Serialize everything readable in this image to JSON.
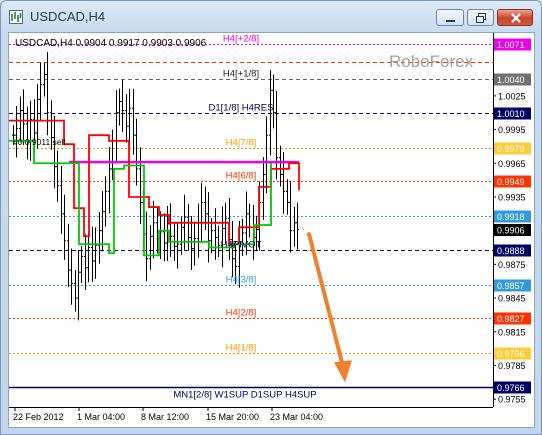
{
  "window": {
    "title": "USDCAD,H4",
    "app_icon": "chart-bars-icon",
    "controls": {
      "minimize": "minimize-icon",
      "maximize": "maximize-icon",
      "close": "close-icon"
    }
  },
  "chart_header": "USDCAD,H4  0.9904 0.9917 0.9903 0.9906",
  "brand": {
    "text": "RoboForex",
    "color": "#a0a0a0"
  },
  "chart_data": {
    "type": "line",
    "symbol": "USDCAD",
    "timeframe": "H4",
    "ohlc": {
      "open": 0.9904,
      "high": 0.9917,
      "low": 0.9903,
      "close": 0.9906
    },
    "ylim": [
      0.9748,
      1.0081
    ],
    "price_ticks": [
      1.0025,
      0.9995,
      0.9965,
      0.9935,
      0.9875,
      0.9845,
      0.9815,
      0.9785,
      0.9755
    ],
    "time_ticks": [
      "22 Feb 2012",
      "1 Mar 04:00",
      "8 Mar 12:00",
      "15 Mar 20:00",
      "23 Mar 04:00"
    ],
    "grid": false,
    "levels": [
      {
        "label": "H4[+2/8]",
        "price": 1.0071,
        "label_color": "#ee00ee",
        "line_color": "#ee00ee",
        "badge_bg": "#ee00ee",
        "badge_fg": "#ffffff",
        "style": "dotted",
        "label_pos": "center"
      },
      {
        "label": "",
        "price": 1.0055,
        "label_color": "#ff3300",
        "line_color": "#ff3300",
        "badge_bg": "",
        "badge_fg": "",
        "style": "dashed",
        "label_pos": "center"
      },
      {
        "label": "H4[+1/8]",
        "price": 1.004,
        "label_color": "#222222",
        "line_color": "#666666",
        "badge_bg": "#707070",
        "badge_fg": "#ffffff",
        "style": "dashed",
        "label_pos": "center"
      },
      {
        "label": "D1[1/8] H4RES",
        "price": 1.001,
        "label_color": "#000066",
        "line_color": "#000066",
        "badge_bg": "#000066",
        "badge_fg": "#ffffff",
        "style": "dashed",
        "label_pos": "center"
      },
      {
        "label": "H4[7/8]",
        "price": 0.9979,
        "label_color": "#ff9900",
        "line_color": "#b8b800",
        "badge_bg": "#ffcc33",
        "badge_fg": "#ffffff",
        "style": "dotted",
        "label_pos": "center"
      },
      {
        "label": "H4[6/8]",
        "price": 0.9949,
        "label_color": "#ff3300",
        "line_color": "#ff3300",
        "badge_bg": "#ff3300",
        "badge_fg": "#ffffff",
        "style": "dotted",
        "label_pos": "center"
      },
      {
        "label": "",
        "price": 0.9918,
        "label_color": "#3399dd",
        "line_color": "#3399dd",
        "badge_bg": "#3399dd",
        "badge_fg": "#ffffff",
        "style": "dotted",
        "label_pos": "center"
      },
      {
        "label": "H4PIVOT",
        "price": 0.9888,
        "label_color": "#000066",
        "line_color": "#000066",
        "badge_bg": "#000066",
        "badge_fg": "#ffffff",
        "style": "dashed",
        "label_pos": "center"
      },
      {
        "label": "H4[3/8]",
        "price": 0.9857,
        "label_color": "#3399dd",
        "line_color": "#3399dd",
        "badge_bg": "#3399dd",
        "badge_fg": "#ffffff",
        "style": "dotted",
        "label_pos": "center"
      },
      {
        "label": "H4[2/8]",
        "price": 0.9827,
        "label_color": "#ff3300",
        "line_color": "#ff3300",
        "badge_bg": "#ff3300",
        "badge_fg": "#ffffff",
        "style": "dotted",
        "label_pos": "center"
      },
      {
        "label": "H4[1/8]",
        "price": 0.9796,
        "label_color": "#ff9900",
        "line_color": "#ff9900",
        "badge_bg": "#ffcc33",
        "badge_fg": "#ffffff",
        "style": "dotted",
        "label_pos": "center"
      },
      {
        "label": "MN1[2/8] W1SUP D1SUP H4SUP",
        "price": 0.9766,
        "label_color": "#000066",
        "line_color": "#000066",
        "badge_bg": "#000066",
        "badge_fg": "#ffffff",
        "style": "solid",
        "label_pos": "center"
      }
    ],
    "current_price": {
      "price": 0.9906,
      "badge_bg": "#000000",
      "badge_fg": "#ffffff"
    },
    "left_label": {
      "text": "#0 0.9011 sell",
      "price": 0.9984
    },
    "bars_close": [
      0.999,
      0.9996,
      1.0012,
      1.0,
      0.9984,
      1.0004,
      0.9992,
      1.0022,
      1.0035,
      1.0044,
      1.001,
      0.9988,
      0.9962,
      0.9945,
      0.992,
      0.9896,
      0.987,
      0.9858,
      0.9845,
      0.9868,
      0.9882,
      0.9872,
      0.989,
      0.9878,
      0.9892,
      0.9905,
      0.9922,
      0.994,
      0.996,
      0.9985,
      1.001,
      1.002,
      1.0012,
      0.9998,
      1.0014,
      0.999,
      0.996,
      0.993,
      0.9902,
      0.988,
      0.99,
      0.9912,
      0.9898,
      0.9904,
      0.9894,
      0.9911,
      0.99,
      0.9891,
      0.9893,
      0.9908,
      0.9917,
      0.9899,
      0.9889,
      0.9898,
      0.9912,
      0.993,
      0.992,
      0.9896,
      0.9905,
      0.9899,
      0.9892,
      0.9907,
      0.9916,
      0.9897,
      0.988,
      0.9873,
      0.9895,
      0.9903,
      0.992,
      0.9908,
      0.9899,
      0.9906,
      0.993,
      0.9955,
      0.999,
      1.003,
      1.001,
      0.997,
      0.9955,
      0.994,
      0.993,
      0.9905,
      0.9912,
      0.9906
    ],
    "series": [
      {
        "name": "",
        "color": "#ee00ee",
        "values": [
          0.9966,
          0.9966,
          0.9966,
          0.9966,
          0.9966,
          0.9966
        ]
      },
      {
        "name": "",
        "color": "#ff0000",
        "values": [
          1.0003,
          0.9982,
          0.9925,
          0.99,
          0.999,
          0.9985,
          0.9935,
          0.9926,
          0.9919,
          0.9912,
          0.9912,
          0.9893,
          0.9908,
          0.9944,
          0.996,
          0.9965,
          0.9941
        ]
      },
      {
        "name": "",
        "color": "#00cc00",
        "values": [
          0.9985,
          0.9985,
          0.9965,
          0.9893,
          0.9885,
          0.996,
          0.9963,
          0.9883,
          0.9905,
          0.9895,
          0.989,
          0.9893,
          0.991,
          0.9965
        ]
      }
    ],
    "arrow": {
      "from_price": 0.9902,
      "to_price": 0.977,
      "color": "#f08030"
    }
  }
}
